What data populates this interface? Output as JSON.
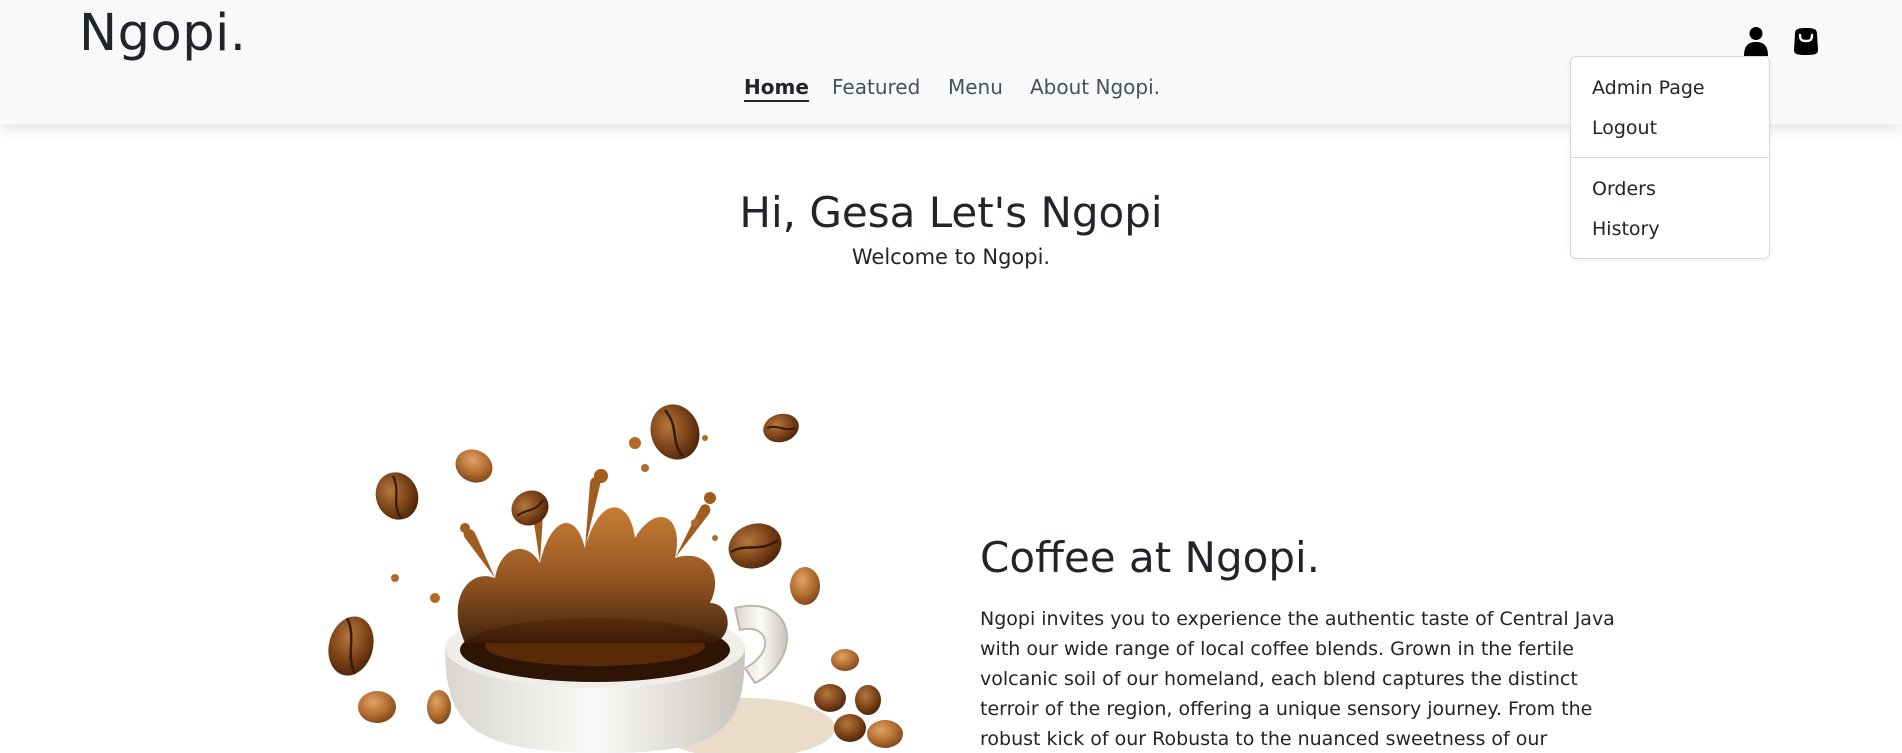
{
  "brand": "Ngopi.",
  "nav": {
    "home": "Home",
    "featured": "Featured",
    "menu": "Menu",
    "about": "About Ngopi."
  },
  "icons": {
    "user": "user-icon",
    "cart": "shopping-bag-icon"
  },
  "user_menu": {
    "admin": "Admin Page",
    "logout": "Logout",
    "orders": "Orders",
    "history": "History"
  },
  "hero": {
    "title": "Hi, Gesa Let's Ngopi",
    "subtitle": "Welcome to Ngopi."
  },
  "about": {
    "title": "Coffee at Ngopi.",
    "lines": [
      "Ngopi invites you to experience the authentic taste of Central Java",
      "with our wide range of local coffee blends. Grown in the fertile",
      "volcanic soil of our homeland, each blend captures the distinct",
      "terroir of the region, offering a unique sensory journey. From the",
      "robust kick of our Robusta to the nuanced sweetness of our"
    ]
  },
  "colors": {
    "navbar_bg": "#f8f9fa",
    "text": "#212529",
    "coffee": "#8a4f1c"
  }
}
